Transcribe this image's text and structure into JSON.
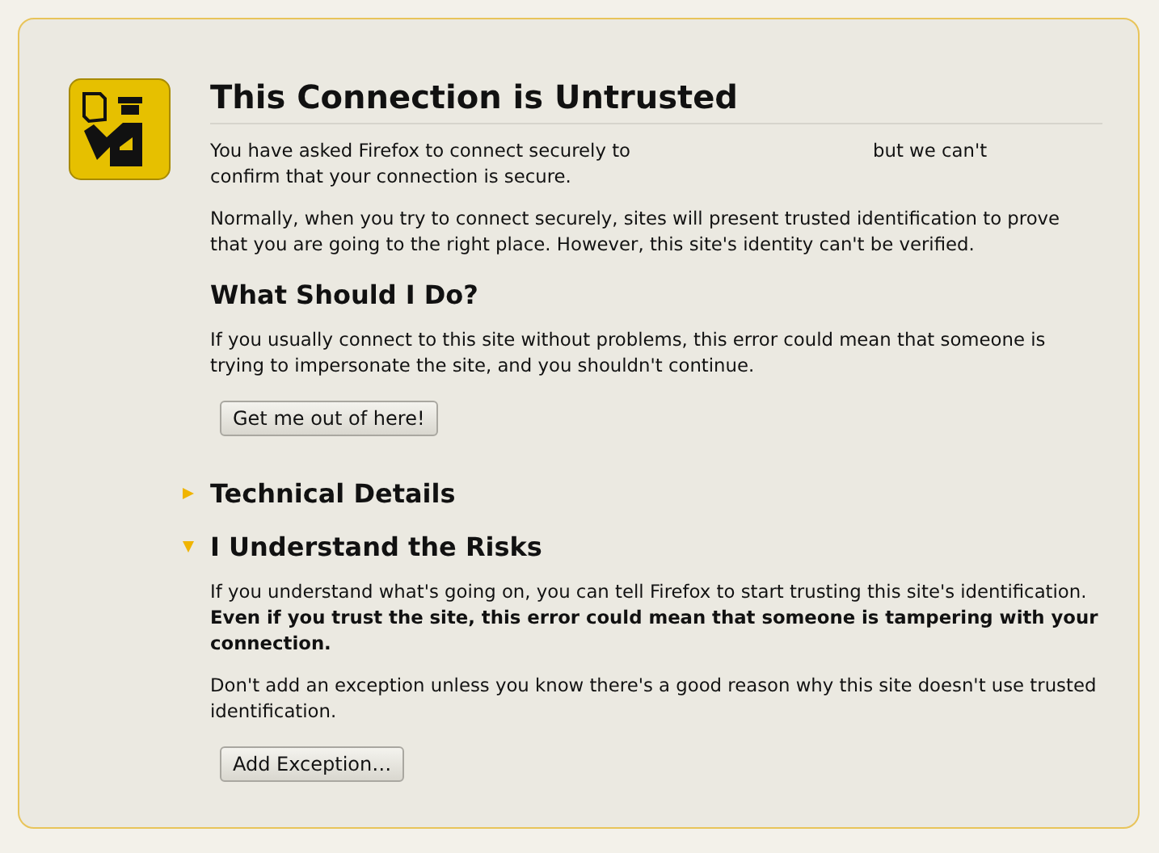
{
  "title": "This Connection is Untrusted",
  "intro": {
    "before": "You have asked Firefox to connect securely to",
    "after": "but we can't",
    "continued": "confirm that your connection is secure."
  },
  "explanation": "Normally, when you try to connect securely, sites will present trusted identification to prove that you are going to the right place. However, this site's identity can't be verified.",
  "what_to_do": {
    "heading": "What Should I Do?",
    "text": "If you usually connect to this site without problems, this error could mean that someone is trying to impersonate the site, and you shouldn't continue.",
    "button": "Get me out of here!"
  },
  "sections": [
    {
      "heading": "Technical Details",
      "expanded": false
    },
    {
      "heading": "I Understand the Risks",
      "expanded": true,
      "paragraphs": [
        "If you understand what's going on, you can tell Firefox to start trusting this site's identification. **Even if you trust the site, this error could mean that someone is tampering with your connection.**",
        "Don't add an exception unless you know there's a good reason why this site doesn't use trusted identification."
      ],
      "button": "Add Exception…"
    }
  ]
}
